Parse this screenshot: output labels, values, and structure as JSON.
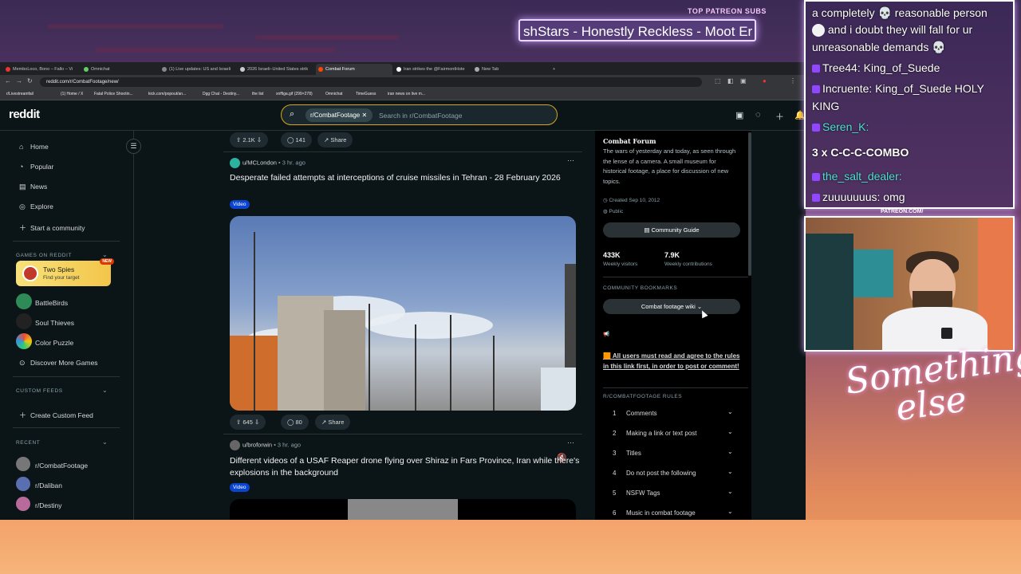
{
  "overlay": {
    "patreon_label": "TOP PATREON SUBS",
    "ticker_text": "shStars - Honestly Reckless - Moot Er",
    "patreon_sig": "PATREON.COM/",
    "signature_line1": "Something",
    "signature_line2": "else"
  },
  "browser": {
    "tabs": [
      {
        "label": "MemboLoco, Bono – Fallo – Vi"
      },
      {
        "label": "Omnichat"
      },
      {
        "label": "(1) Live updates: US and Israeli"
      },
      {
        "label": "2026 Israeli–United States strik"
      },
      {
        "label": "Combat Forum"
      },
      {
        "label": "Iran strikes the @FairmontHote"
      },
      {
        "label": "New Tab"
      }
    ],
    "url": "reddit.com/r/CombatFootage/new/",
    "bookmarks": [
      "r/Livestreamfail",
      "(1) Home / X",
      "Fatal Police Shootin...",
      "kick.com/popout/an...",
      "Dgg Chat - Destiny...",
      "the list",
      "xnffiga.gif (299×278)",
      "Omnichat",
      "TimeGuess",
      "iran news on live m..."
    ]
  },
  "reddit": {
    "logo": "reddit",
    "search": {
      "chip": "r/CombatFootage",
      "placeholder": "Search in r/CombatFootage"
    },
    "nav": [
      {
        "icon": "home-icon",
        "label": "Home"
      },
      {
        "icon": "popular-icon",
        "label": "Popular"
      },
      {
        "icon": "news-icon",
        "label": "News"
      },
      {
        "icon": "explore-icon",
        "label": "Explore"
      },
      {
        "icon": "plus-icon",
        "label": "Start a community"
      }
    ],
    "games_header": "GAMES ON REDDIT",
    "featured_game": {
      "title": "Two Spies",
      "subtitle": "Find your target",
      "badge": "NEW"
    },
    "games": [
      "BattleBirds",
      "Soul Thieves",
      "Color Puzzle",
      "Discover More Games"
    ],
    "custom_feeds_header": "CUSTOM FEEDS",
    "create_feed": "Create Custom Feed",
    "recent_header": "RECENT",
    "recent": [
      "r/CombatFootage",
      "r/Daliban",
      "r/Destiny"
    ]
  },
  "feed": {
    "top_actions": {
      "votes": "2.1K",
      "comments": "141",
      "share": "Share"
    },
    "posts": [
      {
        "author": "u/MCLondon",
        "time": "• 3 hr. ago",
        "title": "Desperate failed attempts at interceptions of cruise missiles in Tehran - 28 February 2026",
        "tag": "Video",
        "votes": "645",
        "comments": "80",
        "share": "Share"
      },
      {
        "author": "u/broforwin",
        "time": "• 3 hr. ago",
        "title": "Different videos of a USAF Reaper drone flying over Shiraz in Fars Province, Iran while there's explosions in the background",
        "tag": "Video"
      }
    ]
  },
  "sidebar": {
    "title": "Combat Forum",
    "description": "The wars of yesterday and today, as seen through the lense of a camera. A small museum for historical footage, a place for discussion of new topics.",
    "created": "Created Sep 10, 2012",
    "visibility": "Public",
    "guide_button": "Community Guide",
    "visitors": "433K",
    "visitors_label": "Weekly visitors",
    "contributions": "7.9K",
    "contributions_label": "Weekly contributions",
    "bookmarks_header": "COMMUNITY BOOKMARKS",
    "wiki_button": "Combat footage wiki",
    "notice": "All users must read and agree to the rules in this link first, in order to post or comment!",
    "rules_header": "R/COMBATFOOTAGE RULES",
    "rules": [
      {
        "n": "1",
        "label": "Comments"
      },
      {
        "n": "2",
        "label": "Making a link or text post"
      },
      {
        "n": "3",
        "label": "Titles"
      },
      {
        "n": "4",
        "label": "Do not post the following"
      },
      {
        "n": "5",
        "label": "NSFW Tags"
      },
      {
        "n": "6",
        "label": "Music in combat footage"
      }
    ]
  },
  "chat": {
    "lines": [
      {
        "text": "a completely 💀 reasonable person"
      },
      {
        "text": "and i doubt they will fall for ur"
      },
      {
        "text": "unreasonable demands 💀"
      },
      {
        "user": "Tree44",
        "text": ": King_of_Suede"
      },
      {
        "user": "Incruente",
        "text": ": King_of_Suede HOLY"
      },
      {
        "text": "KING"
      },
      {
        "user": "Seren_K",
        "text": ":"
      },
      {
        "text": "3 x C-C-C-COMBO"
      },
      {
        "user": "the_salt_dealer",
        "text": ":"
      },
      {
        "user": "zuuuuuuus",
        "text": ": omg"
      }
    ]
  },
  "colors": {
    "accent": "#d6a51f",
    "tag_blue": "#0a45d1",
    "overlay_glow": "#d0a8ff"
  }
}
